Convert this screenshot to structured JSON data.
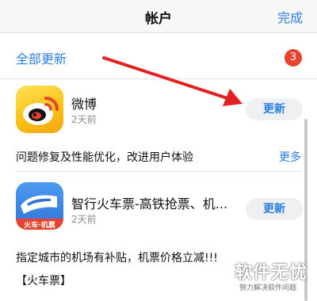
{
  "nav": {
    "title": "帐户",
    "done_label": "完成"
  },
  "updates": {
    "update_all_label": "全部更新",
    "count": "3"
  },
  "apps": [
    {
      "name": "微博",
      "date": "2天前",
      "button_label": "更新",
      "release_notes": "问题修复及性能优化，改进用户体验",
      "more_label": "更多",
      "icon": "weibo-logo-icon"
    },
    {
      "name": "智行火车票-高铁抢票、机...",
      "date": "2天前",
      "button_label": "更新",
      "icon_caption": "火车·机票",
      "release_notes_line1": "指定城市的机场有补贴，机票价格立减!!!",
      "release_notes_line2": "【火车票】",
      "icon": "train-ticket-app-icon"
    }
  ],
  "watermark": {
    "main": "软件无忧",
    "sub": "努力解决软件问题"
  },
  "colors": {
    "accent": "#2a7de1",
    "badge": "#e8432f",
    "arrow": "#e22020"
  }
}
